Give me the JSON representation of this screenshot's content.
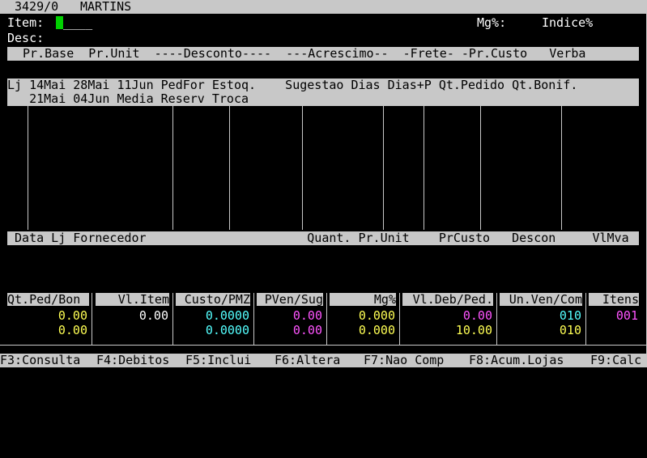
{
  "title": {
    "code": "3429/0",
    "name": "MARTINS"
  },
  "item": {
    "label": "Item:",
    "value": "____"
  },
  "mg_label": "Mg%:",
  "indice_label": "Indice%",
  "desc_label": "Desc:",
  "price_header": " Pr.Base  Pr.Unit  ----Desconto----  ---Acrescimo--  -Frete- -Pr.Custo   Verba",
  "sales_header": {
    "line1": "Lj 14Mai 28Mai 11Jun PedFor Estoq.    Sugestao Dias Dias+P Qt.Pedido Qt.Bonif.",
    "line2": "   21Mai 04Jun Media Reserv Troca"
  },
  "history_header": " Data Lj Fornecedor                      Quant. Pr.Unit    PrCusto   Descon     VlMva",
  "summary": {
    "labels": [
      "Qt.Ped/Bon",
      "Vl.Item",
      "Custo/PMZ",
      "PVen/Sug",
      "Mg%",
      "Vl.Deb/Ped.",
      "Un.Ven/Com",
      "Itens"
    ],
    "row1": [
      "0.00",
      "0.00",
      "0.0000",
      "0.00",
      "0.000",
      "0.00",
      "010",
      "001"
    ],
    "row2": [
      "0.00",
      "",
      "0.0000",
      "0.00",
      "0.000",
      "10.00",
      "010",
      ""
    ]
  },
  "function_keys": [
    "F3:Consulta",
    "F4:Debitos",
    "F5:Inclui",
    "F6:Altera",
    "F7:Nao Comp",
    "F8:Acum.Lojas",
    "F9:Calc"
  ]
}
